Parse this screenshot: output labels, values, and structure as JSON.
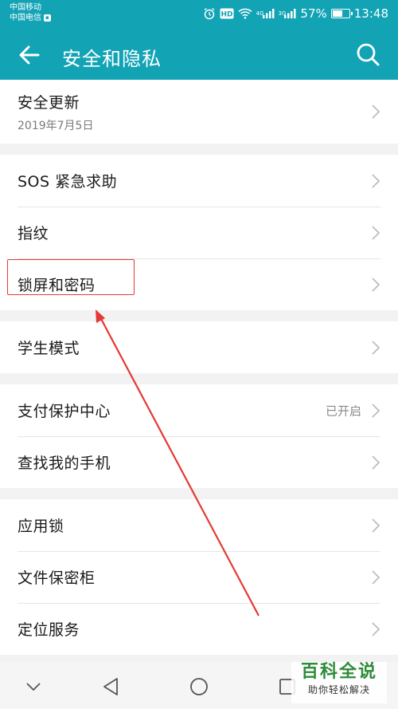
{
  "status_bar": {
    "carrier1": "中国移动",
    "carrier2": "中国电信",
    "hd": "HD",
    "net1": "4G",
    "net2": "3G",
    "battery": "57%",
    "battery_level": 0.57,
    "time": "13:48"
  },
  "toolbar": {
    "title": "安全和隐私"
  },
  "groups": [
    {
      "items": [
        {
          "title": "安全更新",
          "subtitle": "2019年7月5日"
        }
      ]
    },
    {
      "items": [
        {
          "title": "SOS 紧急求助"
        },
        {
          "title": "指纹"
        },
        {
          "title": "锁屏和密码"
        }
      ]
    },
    {
      "items": [
        {
          "title": "学生模式"
        }
      ]
    },
    {
      "items": [
        {
          "title": "支付保护中心",
          "value": "已开启"
        },
        {
          "title": "查找我的手机"
        }
      ]
    },
    {
      "items": [
        {
          "title": "应用锁"
        },
        {
          "title": "文件保密柜"
        },
        {
          "title": "定位服务"
        }
      ]
    }
  ],
  "watermark": {
    "title": "百科全说",
    "subtitle": "助你轻松解决"
  },
  "colors": {
    "primary": "#12a3b5",
    "highlight": "#e53935",
    "watermark": "#2e8b3a"
  }
}
